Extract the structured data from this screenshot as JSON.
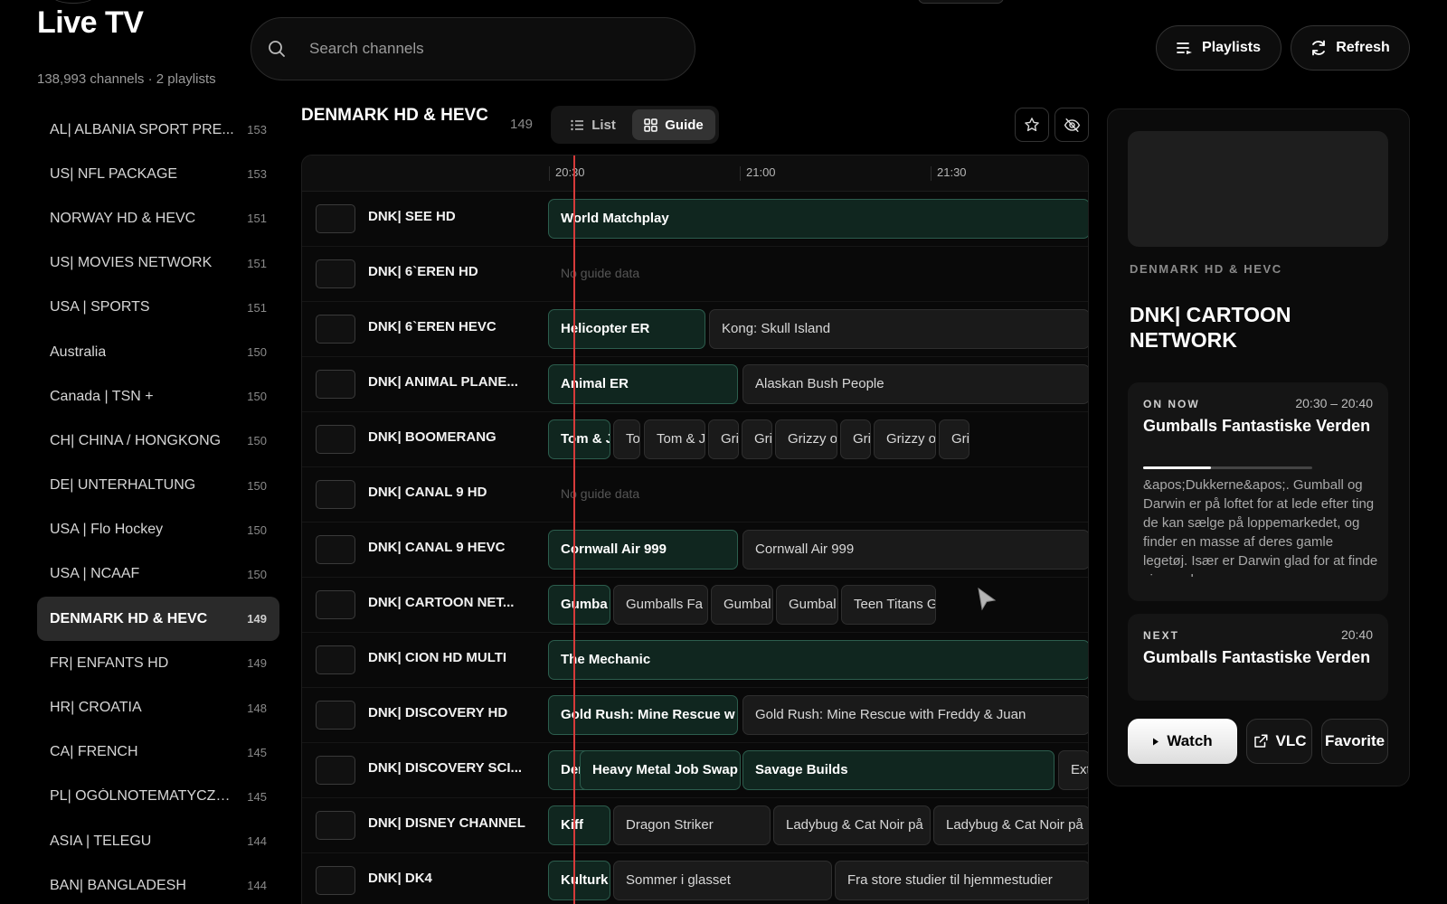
{
  "app": {
    "title": "Live TV",
    "subtitle": "138,993 channels · 2 playlists"
  },
  "search": {
    "placeholder": "Search channels"
  },
  "header_buttons": {
    "playlists": "Playlists",
    "refresh": "Refresh"
  },
  "sidebar": {
    "items": [
      {
        "label": "AL| ALBANIA SPORT PRE...",
        "count": "153"
      },
      {
        "label": "US| NFL PACKAGE",
        "count": "153"
      },
      {
        "label": "NORWAY HD & HEVC",
        "count": "151"
      },
      {
        "label": "US| MOVIES NETWORK",
        "count": "151"
      },
      {
        "label": "USA | SPORTS",
        "count": "151"
      },
      {
        "label": "Australia",
        "count": "150"
      },
      {
        "label": "Canada | TSN +",
        "count": "150"
      },
      {
        "label": "CH| CHINA / HONGKONG",
        "count": "150"
      },
      {
        "label": "DE| UNTERHALTUNG",
        "count": "150"
      },
      {
        "label": "USA | Flo Hockey",
        "count": "150"
      },
      {
        "label": "USA | NCAAF",
        "count": "150"
      },
      {
        "label": "DENMARK HD & HEVC",
        "count": "149",
        "active": true
      },
      {
        "label": "FR| ENFANTS HD",
        "count": "149"
      },
      {
        "label": "HR| CROATIA",
        "count": "148"
      },
      {
        "label": "CA| FRENCH",
        "count": "145"
      },
      {
        "label": "PL| OGÓLNOTEMATYCZNE",
        "count": "145"
      },
      {
        "label": "ASIA | TELEGU",
        "count": "144"
      },
      {
        "label": "BAN| BANGLADESH",
        "count": "144"
      }
    ]
  },
  "guide": {
    "group_title": "DENMARK HD & HEVC",
    "group_count": "149",
    "views": {
      "list": "List",
      "guide": "Guide",
      "selected": "Guide"
    },
    "times": [
      "20:30",
      "21:00",
      "21:30"
    ],
    "no_data_text": "No guide data",
    "channels": [
      {
        "name": "DNK| SEE HD",
        "programs": [
          {
            "title": "World Matchplay",
            "now": true
          }
        ]
      },
      {
        "name": "DNK| 6`EREN HD",
        "programs": []
      },
      {
        "name": "DNK| 6`EREN HEVC",
        "programs": [
          {
            "title": "Helicopter ER",
            "now": true
          },
          {
            "title": "Kong: Skull Island"
          }
        ]
      },
      {
        "name": "DNK| ANIMAL PLANE...",
        "programs": [
          {
            "title": "Animal ER",
            "now": true
          },
          {
            "title": "Alaskan Bush People"
          }
        ]
      },
      {
        "name": "DNK| BOOMERANG",
        "programs": [
          {
            "title": "Tom & J",
            "now": true
          },
          {
            "title": "To"
          },
          {
            "title": "Tom & J"
          },
          {
            "title": "Gri"
          },
          {
            "title": "Gri"
          },
          {
            "title": "Grizzy o"
          },
          {
            "title": "Gri"
          },
          {
            "title": "Grizzy o"
          },
          {
            "title": "Gri"
          }
        ]
      },
      {
        "name": "DNK| CANAL 9 HD",
        "programs": []
      },
      {
        "name": "DNK| CANAL 9 HEVC",
        "programs": [
          {
            "title": "Cornwall Air 999",
            "now": true
          },
          {
            "title": "Cornwall Air 999"
          }
        ]
      },
      {
        "name": "DNK| CARTOON NET...",
        "programs": [
          {
            "title": "Gumba",
            "now": true
          },
          {
            "title": "Gumballs Fa"
          },
          {
            "title": "Gumbal"
          },
          {
            "title": "Gumbal"
          },
          {
            "title": "Teen Titans G"
          }
        ]
      },
      {
        "name": "DNK| CION HD MULTI",
        "programs": [
          {
            "title": "The Mechanic",
            "now": true
          }
        ]
      },
      {
        "name": "DNK| DISCOVERY HD",
        "programs": [
          {
            "title": "Gold Rush: Mine Rescue w",
            "now": true
          },
          {
            "title": "Gold Rush: Mine Rescue with Freddy & Juan"
          }
        ]
      },
      {
        "name": "DNK| DISCOVERY SCI...",
        "programs": [
          {
            "title": "Denne kanal har ikke tv-guide",
            "now": true
          },
          {
            "title": "Heavy Metal Job Swap",
            "now": true
          },
          {
            "title": "Savage Builds",
            "now": true
          },
          {
            "title": "Ext"
          }
        ]
      },
      {
        "name": "DNK| DISNEY CHANNEL",
        "programs": [
          {
            "title": "Kiff",
            "now": true
          },
          {
            "title": "Dragon Striker"
          },
          {
            "title": "Ladybug & Cat Noir på"
          },
          {
            "title": "Ladybug & Cat Noir på"
          }
        ]
      },
      {
        "name": "DNK| DK4",
        "programs": [
          {
            "title": "Kulturk",
            "now": true
          },
          {
            "title": "Sommer i glasset"
          },
          {
            "title": "Fra store studier til hjemmestudier"
          }
        ]
      }
    ]
  },
  "detail": {
    "group": "DENMARK HD & HEVC",
    "channel": "DNK| CARTOON NETWORK",
    "on_now": {
      "label": "ON NOW",
      "time": "20:30 – 20:40",
      "title": "Gumballs Fantastiske Verden",
      "progress": 0.4,
      "description": "&apos;Dukkerne&apos;. Gumball og Darwin er på loftet for at lede efter ting de kan sælge på loppemarkedet, og finder en masse af deres gamle legetøj. Især er Darwin glad for at finde sin gamle"
    },
    "next": {
      "label": "NEXT",
      "time": "20:40",
      "title": "Gumballs Fantastiske Verden"
    },
    "actions": {
      "watch": "Watch",
      "vlc": "VLC",
      "favorite": "Favorite"
    }
  },
  "colors": {
    "now_program_bg": "#10261f",
    "now_program_border": "#2c5d4d",
    "now_line": "#d63a3a",
    "active_sidebar": "#2a2a2a"
  }
}
